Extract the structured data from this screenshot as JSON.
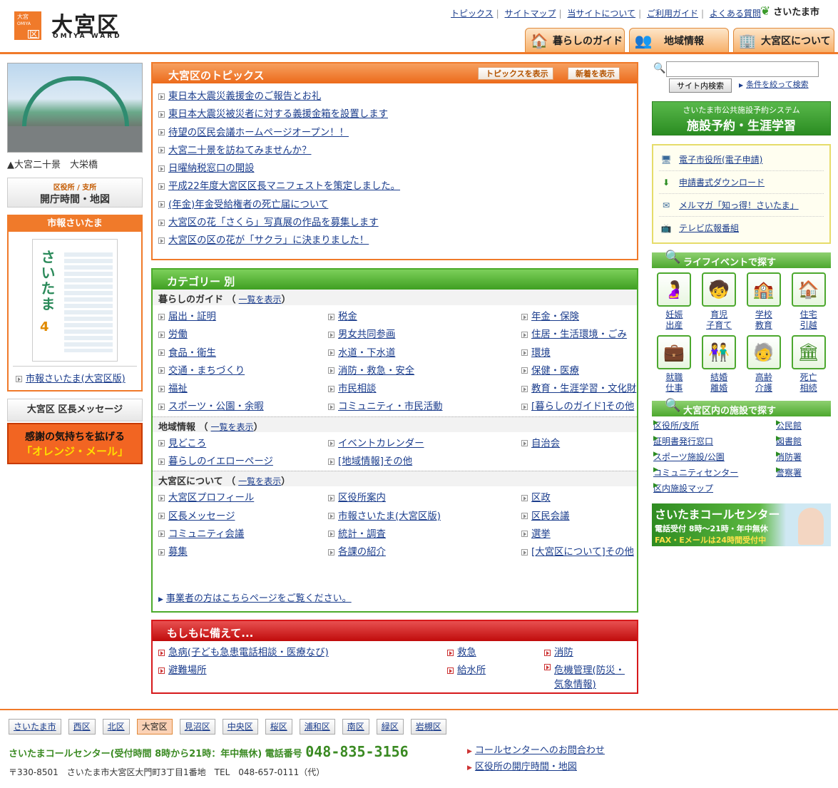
{
  "header": {
    "logo_small_top": "大宮",
    "logo_small_mid": "OMIYA",
    "logo_small_char": "区",
    "title": "大宮区",
    "subtitle": "OMIYA WARD",
    "toplinks": [
      "トピックス",
      "サイトマップ",
      "当サイトについて",
      "ご利用ガイド",
      "よくある質問"
    ],
    "city": "さいたま市",
    "tabs": [
      "暮らしのガイド",
      "地域情報",
      "大宮区について"
    ]
  },
  "left": {
    "photo_caption": "▲大宮二十景　大栄橋",
    "office_small": "区役所 / 支所",
    "office_big": "開庁時間・地図",
    "shiho_title": "市報さいたま",
    "mag_title": "さいたま",
    "mag_num": "4",
    "shiho_link": "市報さいたま(大宮区版)",
    "msg_label": "大宮区 区長メッセージ",
    "mail_line1": "感謝の気持ちを拡げる",
    "mail_line2": "「オレンジ・メール」"
  },
  "topics": {
    "title": "大宮区のトピックス",
    "btn_show": "トピックスを表示",
    "btn_new": "新着を表示",
    "items": [
      "東日本大震災義援金のご報告とお礼",
      "東日本大震災被災者に対する義援金箱を設置します",
      "待望の区民会議ホームページオープン！！",
      "大宮二十景を訪ねてみませんか？",
      "日曜納税窓口の開設",
      "平成22年度大宮区区長マニフェストを策定しました。",
      "(年金)年金受給権者の死亡届について",
      "大宮区の花「さくら」写真展の作品を募集します",
      "大宮区の区の花が「サクラ」に決まりました！"
    ]
  },
  "category": {
    "title": "カテゴリー 別",
    "list_label": "一覧を表示",
    "sections": [
      {
        "title": "暮らしのガイド",
        "rows": [
          [
            "届出・証明",
            "税金",
            "年金・保険"
          ],
          [
            "労働",
            "男女共同参画",
            "住居・生活環境・ごみ"
          ],
          [
            "食品・衛生",
            "水道・下水道",
            "環境"
          ],
          [
            "交通・まちづくり",
            "消防・救急・安全",
            "保健・医療"
          ],
          [
            "福祉",
            "市民相談",
            "教育・生涯学習・文化財"
          ],
          [
            "スポーツ・公園・余暇",
            "コミュニティ・市民活動",
            "[暮らしのガイド]その他"
          ]
        ]
      },
      {
        "title": "地域情報",
        "rows": [
          [
            "見どころ",
            "イベントカレンダー",
            "自治会"
          ],
          [
            "暮らしのイエローページ",
            "[地域情報]その他",
            ""
          ]
        ]
      },
      {
        "title": "大宮区について",
        "rows": [
          [
            "大宮区プロフィール",
            "区役所案内",
            "区政"
          ],
          [
            "区長メッセージ",
            "市報さいたま(大宮区版)",
            "区民会議"
          ],
          [
            "コミュニティ会議",
            "統計・調査",
            "選挙"
          ],
          [
            "募集",
            "各課の紹介",
            "[大宮区について]その他"
          ]
        ]
      }
    ],
    "biz_link": "事業者の方はこちらページをご覧ください。"
  },
  "moshimo": {
    "title": "もしもに備えて...",
    "rows": [
      [
        "急病(子ども急患電話相談・医療なび)",
        "救急",
        "消防"
      ],
      [
        "避難場所",
        "給水所",
        "危機管理(防災・気象情報)"
      ]
    ]
  },
  "right": {
    "search_btn": "サイト内検索",
    "search_adv": "条件を絞って検索",
    "booking_small": "さいたま市公共施設予約システム",
    "booking_big": "施設予約・生涯学習",
    "services": [
      "電子市役所(電子申請)",
      "申請書式ダウンロード",
      "メルマガ「知っ得！さいたま」",
      "テレビ広報番組"
    ],
    "life_title": "ライフイベントで探す",
    "life": [
      [
        "妊娠",
        "出産"
      ],
      [
        "育児",
        "子育て"
      ],
      [
        "学校",
        "教育"
      ],
      [
        "住宅",
        "引越"
      ],
      [
        "就職",
        "仕事"
      ],
      [
        "結婚",
        "離婚"
      ],
      [
        "高齢",
        "介護"
      ],
      [
        "死亡",
        "相続"
      ]
    ],
    "facility_title": "大宮区内の施設で探す",
    "facility": [
      "区役所/支所",
      "公民館",
      "証明書発行窓口",
      "図書館",
      "スポーツ施設/公園",
      "消防署",
      "コミュニティセンター",
      "警察署",
      "区内施設マップ"
    ],
    "cc_title": "さいたまコールセンター",
    "cc_line1": "電話受付 8時～21時・年中無休",
    "cc_line2": "FAX・Eメールは24時間受付中"
  },
  "footer": {
    "wards": [
      "さいたま市",
      "西区",
      "北区",
      "大宮区",
      "見沼区",
      "中央区",
      "桜区",
      "浦和区",
      "南区",
      "緑区",
      "岩槻区"
    ],
    "active_ward": "大宮区",
    "cc_text": "さいたまコールセンター(受付時間 8時から21時：年中無休) 電話番号",
    "cc_number": "048-835-3156",
    "address": "〒330-8501　さいたま市大宮区大門町3丁目1番地　TEL　048-657-0111（代）",
    "links": [
      "コールセンターへのお問合わせ",
      "区役所の開庁時間・地図"
    ]
  }
}
